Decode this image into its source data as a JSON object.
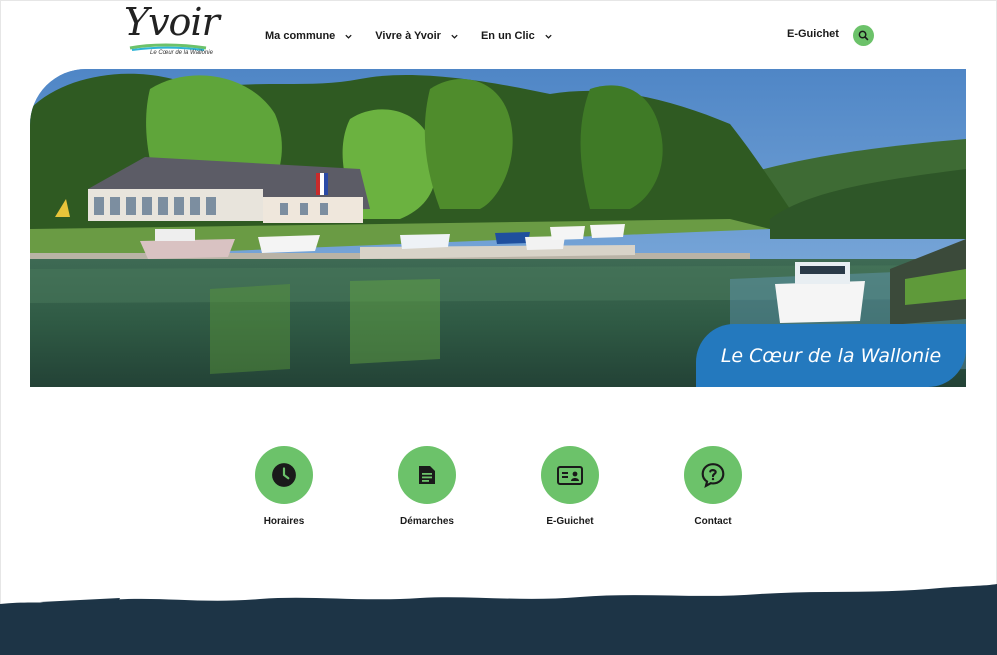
{
  "header": {
    "logo": {
      "word": "Yvoir",
      "tagline": "Le Cœur de la Wallonie"
    },
    "nav": [
      {
        "label": "Ma commune"
      },
      {
        "label": "Vivre à Yvoir"
      },
      {
        "label": "En un Clic"
      }
    ],
    "eguichet_label": "E-Guichet",
    "search_icon": "search-icon"
  },
  "hero": {
    "caption": "Le Cœur de la Wallonie"
  },
  "quick_links": [
    {
      "label": "Horaires",
      "icon": "clock-icon"
    },
    {
      "label": "Démarches",
      "icon": "document-icon"
    },
    {
      "label": "E-Guichet",
      "icon": "id-card-icon"
    },
    {
      "label": "Contact",
      "icon": "question-bubble-icon"
    }
  ],
  "colors": {
    "accent_green": "#6cc26a",
    "caption_blue": "#2479be",
    "footer_navy": "#1d3446"
  }
}
